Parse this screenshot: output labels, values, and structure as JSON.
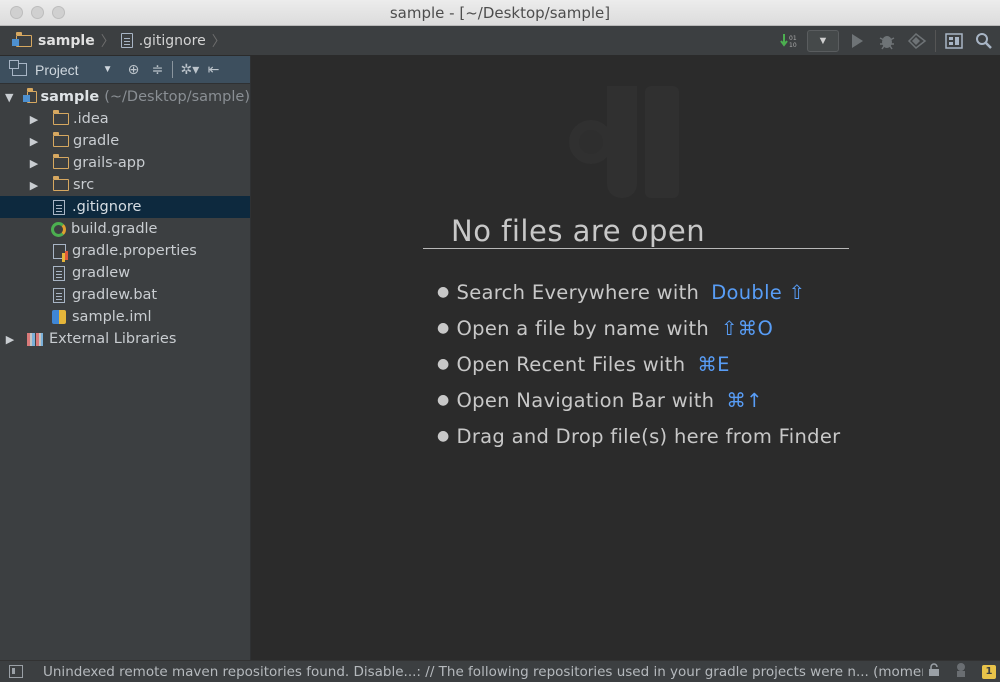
{
  "window": {
    "title": "sample - [~/Desktop/sample]"
  },
  "navbar": {
    "crumbs": [
      {
        "label": "sample",
        "icon": "project-folder-icon"
      },
      {
        "label": ".gitignore",
        "icon": "file-icon"
      }
    ],
    "tools": [
      "vcs-update-icon",
      "run-config-dropdown",
      "run-icon",
      "debug-icon",
      "coverage-icon",
      "project-structure-icon",
      "search-icon"
    ]
  },
  "sidebar": {
    "header": {
      "label": "Project"
    },
    "tree": [
      {
        "label": "sample",
        "suffix": "(~/Desktop/sample)",
        "type": "module",
        "depth": 0,
        "expanded": true
      },
      {
        "label": ".idea",
        "type": "folder",
        "depth": 1
      },
      {
        "label": "gradle",
        "type": "folder",
        "depth": 1
      },
      {
        "label": "grails-app",
        "type": "folder",
        "depth": 1
      },
      {
        "label": "src",
        "type": "folder",
        "depth": 1
      },
      {
        "label": ".gitignore",
        "type": "file",
        "depth": 1,
        "selected": true
      },
      {
        "label": "build.gradle",
        "type": "gradle",
        "depth": 1
      },
      {
        "label": "gradle.properties",
        "type": "properties",
        "depth": 1
      },
      {
        "label": "gradlew",
        "type": "file",
        "depth": 1
      },
      {
        "label": "gradlew.bat",
        "type": "file",
        "depth": 1
      },
      {
        "label": "sample.iml",
        "type": "iml",
        "depth": 1
      },
      {
        "label": "External Libraries",
        "type": "libraries",
        "depth": 0
      }
    ]
  },
  "editor": {
    "empty_title": "No files are open",
    "hints": [
      {
        "text": "Search Everywhere with",
        "key": "Double ⇧"
      },
      {
        "text": "Open a file by name with",
        "key": "⇧⌘O"
      },
      {
        "text": "Open Recent Files with",
        "key": "⌘E"
      },
      {
        "text": "Open Navigation Bar with",
        "key": "⌘↑"
      },
      {
        "text": "Drag and Drop file(s) here from Finder",
        "key": ""
      }
    ]
  },
  "statusbar": {
    "message": "Unindexed remote maven repositories found. Disable...: // The following repositories used in your gradle projects were n... (moments ago)",
    "warning_count": "1"
  },
  "colors": {
    "accent_key": "#589df6",
    "selection": "#0d293e",
    "panel_header": "#3d4f5e",
    "folder": "#d7a860"
  }
}
